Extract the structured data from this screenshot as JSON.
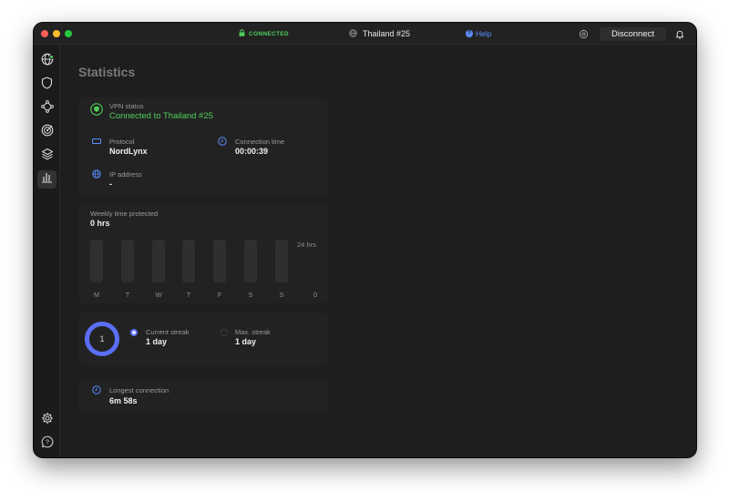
{
  "titlebar": {
    "status": "CONNECTED",
    "server": "Thailand #25",
    "help": "Help",
    "disconnect": "Disconnect"
  },
  "sidebar": {
    "items": [
      {
        "icon": "globe-icon",
        "active": false,
        "connected_dot": true
      },
      {
        "icon": "shield-icon",
        "active": false
      },
      {
        "icon": "meshnet-icon",
        "active": false
      },
      {
        "icon": "target-icon",
        "active": false
      },
      {
        "icon": "layers-icon",
        "active": false
      },
      {
        "icon": "bar-chart-icon",
        "active": true
      }
    ],
    "bottom": [
      {
        "icon": "gear-icon"
      },
      {
        "icon": "help-bubble-icon"
      }
    ]
  },
  "page": {
    "title": "Statistics"
  },
  "vpn": {
    "status_label": "VPN status",
    "status_value": "Connected to Thailand #25",
    "protocol_label": "Protocol",
    "protocol_value": "NordLynx",
    "time_label": "Connection time",
    "time_value": "00:00:39",
    "ip_label": "IP address",
    "ip_value": "-"
  },
  "weekly": {
    "label": "Weekly time protected",
    "value": "0 hrs",
    "axis_max": "24 hrs",
    "axis_min": "0",
    "days": [
      "M",
      "T",
      "W",
      "T",
      "F",
      "S",
      "S"
    ],
    "hours": [
      0,
      0,
      0,
      0,
      0,
      0,
      0
    ]
  },
  "streak": {
    "ring_value": "1",
    "current_label": "Current streak",
    "current_value": "1 day",
    "max_label": "Max. streak",
    "max_value": "1 day"
  },
  "longest": {
    "label": "Longest connection",
    "value": "6m 58s"
  },
  "colors": {
    "accent": "#5b6ef5",
    "connected": "#4fcf5c",
    "link": "#5b8cff"
  }
}
